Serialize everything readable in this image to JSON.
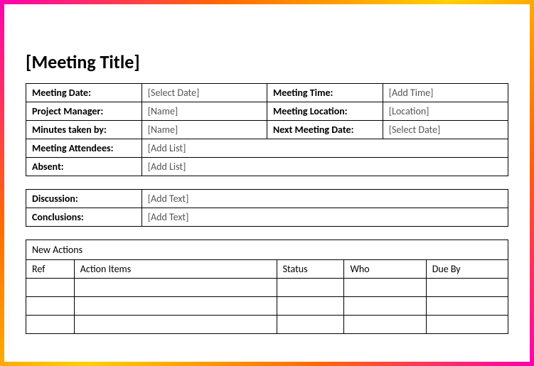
{
  "title": "[Meeting Title]",
  "details": {
    "meeting_date_label": "Meeting Date:",
    "meeting_date_value": "[Select Date]",
    "meeting_time_label": "Meeting Time:",
    "meeting_time_value": "[Add Time]",
    "project_manager_label": "Project Manager:",
    "project_manager_value": "[Name]",
    "meeting_location_label": "Meeting Location:",
    "meeting_location_value": "[Location]",
    "minutes_taken_label": "Minutes taken by:",
    "minutes_taken_value": "[Name]",
    "next_meeting_label": "Next Meeting Date:",
    "next_meeting_value": "[Select Date]",
    "attendees_label": "Meeting Attendees:",
    "attendees_value": "[Add List]",
    "absent_label": "Absent:",
    "absent_value": "[Add List]"
  },
  "notes": {
    "discussion_label": "Discussion:",
    "discussion_value": "[Add Text]",
    "conclusions_label": "Conclusions:",
    "conclusions_value": "[Add Text]"
  },
  "actions": {
    "title": "New Actions",
    "headers": {
      "ref": "Ref",
      "items": "Action Items",
      "status": "Status",
      "who": "Who",
      "due": "Due By"
    }
  }
}
